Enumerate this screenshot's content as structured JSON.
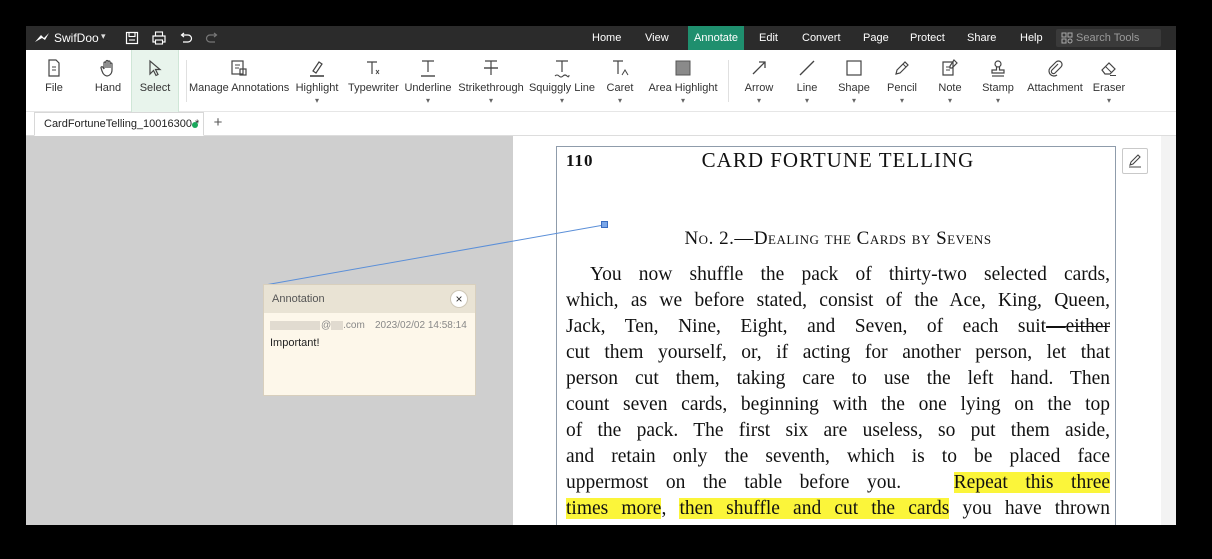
{
  "colors": {
    "titlebar_bg": "#2b2b2b",
    "accent": "#1f8f6e",
    "highlight": "#fbf53a",
    "workspace_bg": "#cfcfcf",
    "popup_bg": "#fdf7ea",
    "connector": "#5b8fd8",
    "modified_dot": "#1aa85c"
  },
  "app": {
    "name": "SwifDoo",
    "caret": "▾"
  },
  "menu": [
    "Home",
    "View",
    "Annotate",
    "Edit",
    "Convert",
    "Page",
    "Protect",
    "Share",
    "Help"
  ],
  "menu_active": "Annotate",
  "search": {
    "placeholder": "Search Tools",
    "icon": "search-tools-icon"
  },
  "ribbon": {
    "tools": [
      {
        "label": "File",
        "icon": "file-icon"
      },
      {
        "label": "Hand",
        "icon": "hand-icon"
      },
      {
        "label": "Select",
        "icon": "select-cursor-icon",
        "selected": true
      },
      {
        "label": "Manage Annotations",
        "icon": "manage-annotations-icon"
      },
      {
        "label": "Highlight",
        "icon": "highlight-icon",
        "dropdown": true
      },
      {
        "label": "Typewriter",
        "icon": "typewriter-icon"
      },
      {
        "label": "Underline",
        "icon": "underline-icon",
        "dropdown": true
      },
      {
        "label": "Strikethrough",
        "icon": "strikethrough-icon",
        "dropdown": true
      },
      {
        "label": "Squiggly Line",
        "icon": "squiggly-line-icon",
        "dropdown": true
      },
      {
        "label": "Caret",
        "icon": "caret-icon",
        "dropdown": true
      },
      {
        "label": "Area Highlight",
        "icon": "area-highlight-icon",
        "dropdown": true
      },
      {
        "label": "Arrow",
        "icon": "arrow-icon",
        "dropdown": true
      },
      {
        "label": "Line",
        "icon": "line-icon",
        "dropdown": true
      },
      {
        "label": "Shape",
        "icon": "shape-icon",
        "dropdown": true
      },
      {
        "label": "Pencil",
        "icon": "pencil-icon",
        "dropdown": true
      },
      {
        "label": "Note",
        "icon": "note-icon",
        "dropdown": true
      },
      {
        "label": "Stamp",
        "icon": "stamp-icon",
        "dropdown": true
      },
      {
        "label": "Attachment",
        "icon": "attachment-icon"
      },
      {
        "label": "Eraser",
        "icon": "eraser-icon",
        "dropdown": true
      }
    ],
    "dropdown_glyph": "▾"
  },
  "tabs": {
    "document": "CardFortuneTelling_10016300 *",
    "new_tab": "+"
  },
  "page": {
    "page_number": "110",
    "running_head": "CARD FORTUNE TELLING",
    "chapter_head": "No. 2.—Dealing the Cards by Sevens",
    "lines": [
      "You now shuffle the pack of thirty-two selected cards,",
      "which, as we before stated, consist of the Ace, King, Queen,",
      "Jack, Ten, Nine, Eight, and Seven, of each suit",
      "cut them yourself, or, if acting for another person, let that",
      "person cut them, taking care to use the left hand.  Then",
      "count seven cards, beginning with the one lying on the top",
      "of the pack.  The first six are useless, so put them aside,",
      "and retain only the seventh, which is to be placed face",
      "uppermost on the table before you.",
      "times more",
      "you have thrown"
    ],
    "struck": "—either",
    "highlight_1": "Repeat this three",
    "comma": ",",
    "highlight_2": "then shuffle and cut the cards"
  },
  "annotation": {
    "title": "Annotation",
    "author_suffix": ".com",
    "author_at": "@",
    "timestamp": "2023/02/02 14:58:14",
    "text": "Important!",
    "close": "×"
  }
}
